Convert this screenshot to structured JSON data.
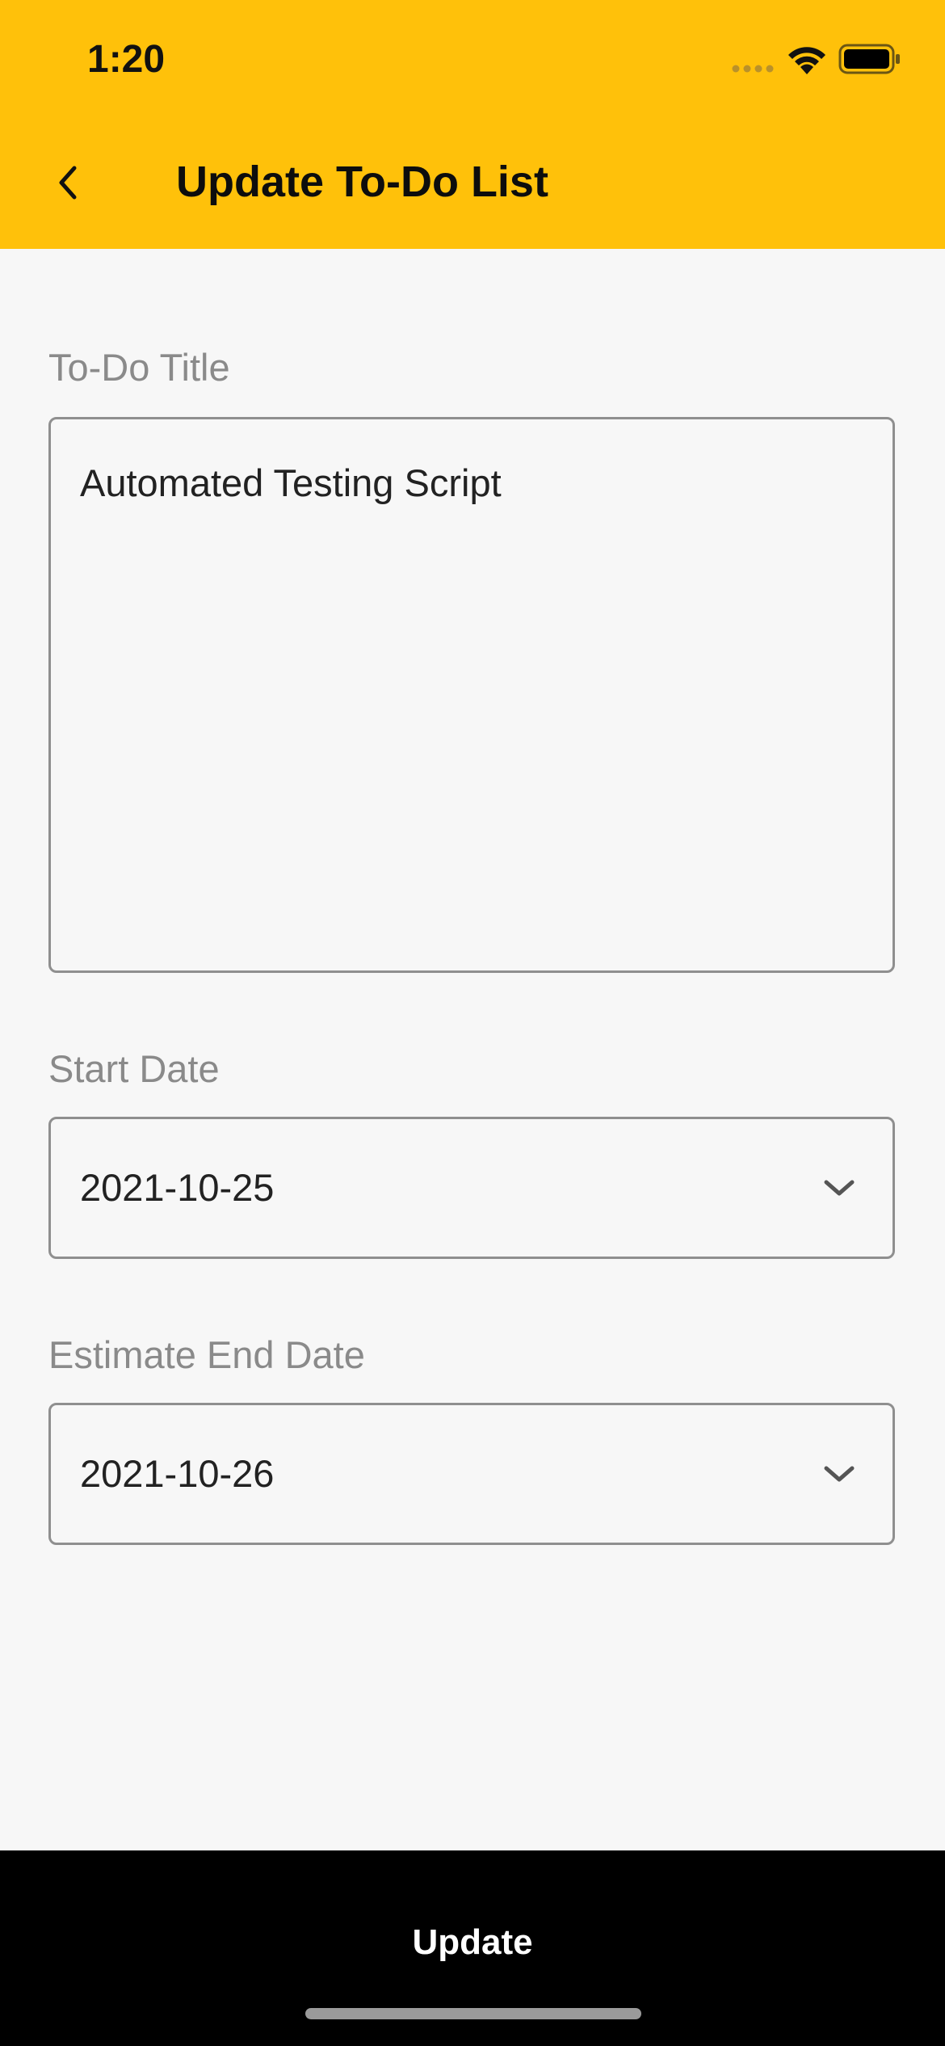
{
  "status_bar": {
    "time": "1:20"
  },
  "header": {
    "title": "Update To-Do List",
    "background_color": "#FFC10A",
    "back_icon": "chevron-left-icon"
  },
  "form": {
    "title_field": {
      "label": "To-Do Title",
      "value": "Automated Testing Script"
    },
    "start_date": {
      "label": "Start Date",
      "value": "2021-10-25",
      "icon": "chevron-down-icon"
    },
    "end_date": {
      "label": "Estimate End Date",
      "value": "2021-10-26",
      "icon": "chevron-down-icon"
    }
  },
  "footer": {
    "update_label": "Update",
    "background_color": "#000000"
  }
}
